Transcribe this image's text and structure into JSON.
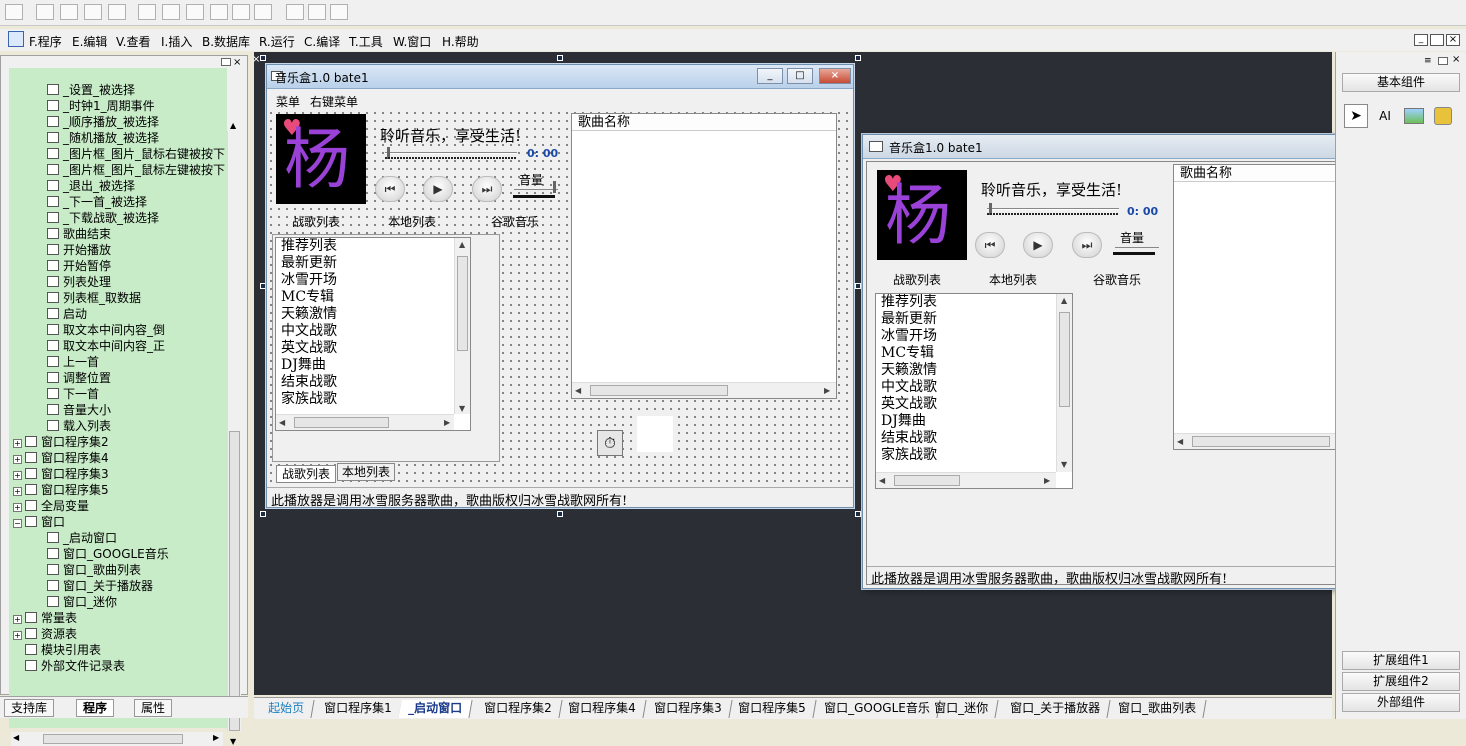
{
  "menu": [
    {
      "key": "F",
      "label": "F.程序"
    },
    {
      "key": "E",
      "label": "E.编辑"
    },
    {
      "key": "V",
      "label": "V.查看"
    },
    {
      "key": "I",
      "label": "I.插入"
    },
    {
      "key": "B",
      "label": "B.数据库"
    },
    {
      "key": "R",
      "label": "R.运行"
    },
    {
      "key": "C",
      "label": "C.编译"
    },
    {
      "key": "T",
      "label": "T.工具"
    },
    {
      "key": "W",
      "label": "W.窗口"
    },
    {
      "key": "H",
      "label": "H.帮助"
    }
  ],
  "tree": {
    "items": [
      "_设置_被选择",
      "_时钟1_周期事件",
      "_顺序播放_被选择",
      "_随机播放_被选择",
      "_图片框_图片_鼠标右键被按下",
      "_图片框_图片_鼠标左键被按下",
      "_退出_被选择",
      "_下一首_被选择",
      "_下载战歌_被选择",
      "歌曲结束",
      "开始播放",
      "开始暂停",
      "列表处理",
      "列表框_取数据",
      "启动",
      "取文本中间内容_倒",
      "取文本中间内容_正",
      "上一首",
      "调整位置",
      "下一首",
      "音量大小",
      "载入列表"
    ],
    "groups": [
      "窗口程序集2",
      "窗口程序集4",
      "窗口程序集3",
      "窗口程序集5",
      "全局变量",
      "窗口"
    ],
    "windows": [
      "_启动窗口",
      "窗口_GOOGLE音乐",
      "窗口_歌曲列表",
      "窗口_关于播放器",
      "窗口_迷你"
    ],
    "others": [
      "常量表",
      "资源表",
      "模块引用表",
      "外部文件记录表"
    ]
  },
  "left_tabs": [
    "支持库",
    "程序",
    "属性"
  ],
  "form": {
    "title": "音乐盒1.0 bate1",
    "menu_items": [
      "菜单",
      "右键菜单"
    ],
    "slogan": "聆听音乐，享受生活!",
    "time": "0: 00",
    "volume_label": "音量",
    "tabs_labels": [
      "战歌列表",
      "本地列表",
      "谷歌音乐"
    ],
    "list": [
      "推荐列表",
      "最新更新",
      "冰雪开场",
      "MC专辑",
      "天籁激情",
      "中文战歌",
      "英文战歌",
      "DJ舞曲",
      "结束战歌",
      "家族战歌"
    ],
    "song_header": "歌曲名称",
    "bottom_tabs": [
      "战歌列表",
      "本地列表"
    ],
    "status": "此播放器是调用冰雪服务器歌曲，歌曲版权归冰雪战歌网所有!"
  },
  "preview": {
    "title": "音乐盒1.0 bate1",
    "slogan": "聆听音乐，享受生活!",
    "time": "0: 00",
    "volume_label": "音量",
    "tabs_labels": [
      "战歌列表",
      "本地列表",
      "谷歌音乐"
    ],
    "list": [
      "推荐列表",
      "最新更新",
      "冰雪开场",
      "MC专辑",
      "天籁激情",
      "中文战歌",
      "英文战歌",
      "DJ舞曲",
      "结束战歌",
      "家族战歌"
    ],
    "song_header": "歌曲名称",
    "status": "此播放器是调用冰雪服务器歌曲，歌曲版权归冰雪战歌网所有!"
  },
  "right_panel": {
    "basic": "基本组件",
    "ext1": "扩展组件1",
    "ext2": "扩展组件2",
    "external": "外部组件",
    "tool_text_icon": "AI"
  },
  "bottom_tabs": [
    "起始页",
    "窗口程序集1",
    "_启动窗口",
    "窗口程序集2",
    "窗口程序集4",
    "窗口程序集3",
    "窗口程序集5",
    "窗口_GOOGLE音乐",
    "窗口_迷你",
    "窗口_关于播放器",
    "窗口_歌曲列表"
  ],
  "logo_text": "杨",
  "colors": {
    "tree_bg": "#c8ecc8",
    "design_bg": "#2b2f35",
    "time_blue": "#1a4aa8",
    "active_tab": "#1a3a8a"
  }
}
